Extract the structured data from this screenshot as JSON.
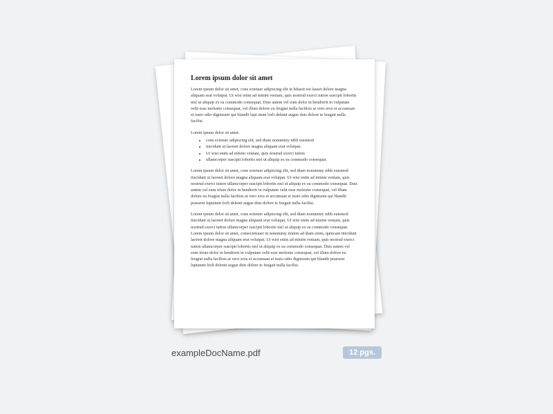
{
  "document": {
    "title": "Lorem ipsum dolor sit amet",
    "para1": "Lorem ipsum dolor sit amet, cons ectetuer adipiscing elit in hibasit est lauset dolore magna aliquam erat volutpat. Ut wisi enim ad minim veniam, quis nostrud exerci tution suscipit lobortis nisl ut aliquip ex ea commodo consequat. Duis autem vel eum dolor in hendrerit in vulputate velit esse molestie consequat, vel illum dolore eu feugiat nulla facilisis at vero eros et accumsan et iusto odio dignissim qui blandit lupt atum lorli delenit augue duis dolore te feugait nulla facilisi.",
    "list_intro": "Lorem ipsum dolor sit amet:",
    "bullets": [
      "cons ectetuer adipiscing elit, sed diam nonummy nibh euismod",
      "tincidunt ut laoreet dolore magna aliquam erat volutpat.",
      "Ut wisi enim ad minim veniam, quis nostrud exerci tution",
      "ullamcorper suscipit lobortis nisl ut aliquip ex ea commodo consequat."
    ],
    "para2": "Lorem ipsum dolor sit amet, cons ectetuer adipiscing elit, sed diam nonummy nibh euismod tincidunt ut laoreet dolore magna aliquam erat volutpat. Ut wisi enim ad minim veniam, quis nostrud exerci tution ullamcorper suscipit lobortis nisl ut aliquip ex ea commodo consequat. Duis autem vel eum iriure dolor in hendrerit in vulputate velit esse molestie consequat, vel illum dolore eu feugiat nulla facilisis at vero eros et accumsan et iusto odio dignissim qui blandit praesent luptatum lorli delenit augue duis dolore te feugait nulla facilisi.",
    "para3": "Lorem ipsum dolor sit amet, cons ectetuer adipiscing elit, sed diam nonummy nibh euismod tincidunt ut laoreet dolore magna aliquam erat volutpat. Ut wisi enim ad minim veniam, quis nostrud exerci tution ullamcorper suscipit lobortis nisl ut aliquip ex ea commodo consequat. Lorem ipsum dolor sit amet, consectetuuer in nonummy minim ad diam enim, quincant tincidunt laoreet dolore magna aliquam erat volutpat. Ut wisi enim ad minim veniam, quis nostrud exerci tution ullamcorper suscipit lobortis nisl ut aliquip ex ea commodo consequat. Duis autem vel eum iriure dolor in hendrerit in vulputate velit esse molestie consequat, vel illum dolore eu feugiat nulla facilisis at vero eros et accumsan et iusto odio dignissim qui blandit praesent luptatum lorli delenit augue duis dolore te feugait nulla facilisi."
  },
  "meta": {
    "filename": "exampleDocName.pdf",
    "page_count_label": "12 pgs."
  }
}
